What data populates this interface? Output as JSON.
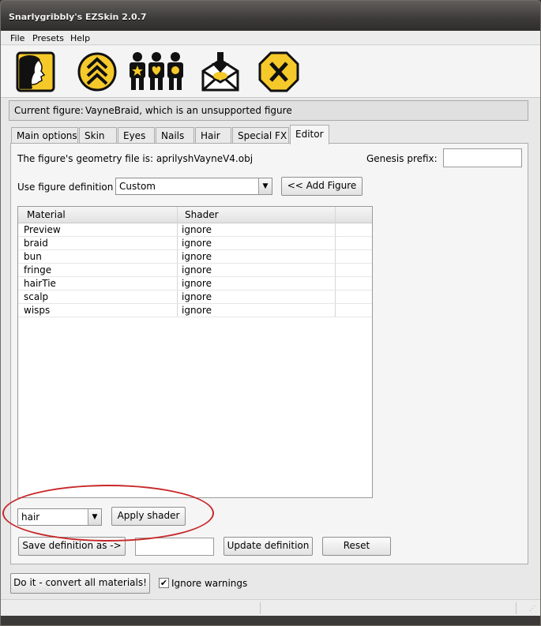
{
  "window": {
    "title": "Snarlygribbly's EZSkin 2.0.7"
  },
  "menu": [
    "File",
    "Presets",
    "Help"
  ],
  "toolbar": {
    "icons": [
      "face-silhouette-icon",
      "chevrons-up-icon",
      "three-figures-icon",
      "envelope-download-icon",
      "close-x-icon"
    ],
    "accent": "#f5c92a"
  },
  "figure_bar": {
    "label": "Current figure:",
    "value": "VayneBraid, which is an unsupported figure"
  },
  "tabs": [
    "Main options",
    "Skin",
    "Eyes",
    "Nails",
    "Hair",
    "Special FX",
    "Editor"
  ],
  "active_tab": "Editor",
  "editor": {
    "geometry_label": "The figure's geometry file is: aprilyshVayneV4.obj",
    "genesis_label": "Genesis prefix:",
    "genesis_value": "",
    "figure_def_label": "Use figure definition",
    "figure_def_value": "Custom",
    "add_figure_button": "<< Add Figure",
    "table": {
      "columns": [
        "Material",
        "Shader"
      ],
      "rows": [
        {
          "material": "Preview",
          "shader": "ignore"
        },
        {
          "material": "braid",
          "shader": "ignore"
        },
        {
          "material": "bun",
          "shader": "ignore"
        },
        {
          "material": "fringe",
          "shader": "ignore"
        },
        {
          "material": "hairTie",
          "shader": "ignore"
        },
        {
          "material": "scalp",
          "shader": "ignore"
        },
        {
          "material": "wisps",
          "shader": "ignore"
        }
      ]
    },
    "shader_select_value": "hair",
    "apply_shader_button": "Apply shader",
    "save_definition_button": "Save definition as ->",
    "save_definition_value": "",
    "update_definition_button": "Update definition",
    "reset_button": "Reset"
  },
  "bottom": {
    "convert_button": "Do it - convert all materials!",
    "ignore_warnings_label": "Ignore warnings",
    "ignore_warnings_checked": true,
    "check_mark": "✔"
  },
  "colors": {
    "highlight_oval": "#c8282a"
  }
}
